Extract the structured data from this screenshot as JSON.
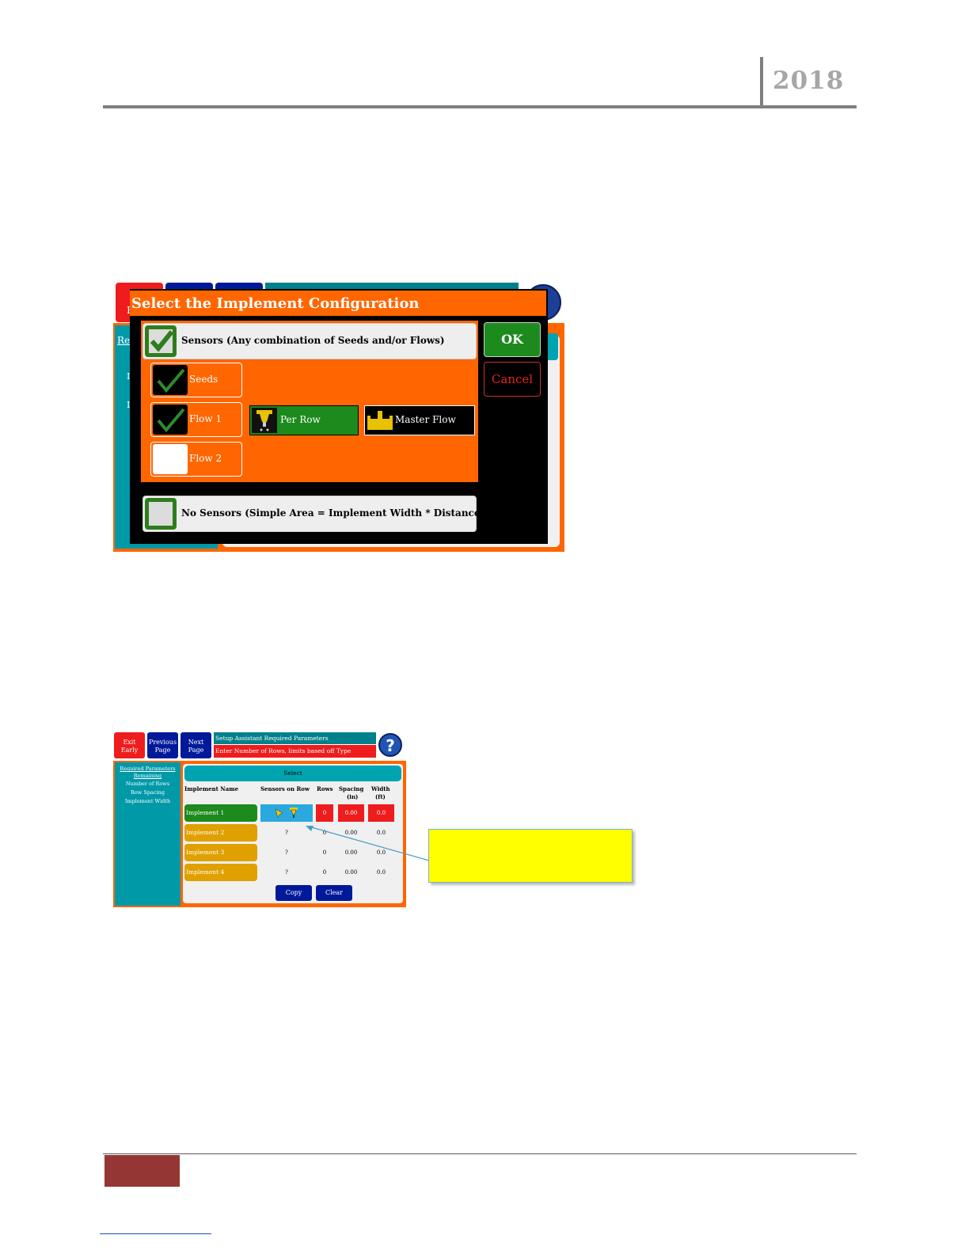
{
  "header": {
    "year": "2018"
  },
  "shot1": {
    "title": "Select the Implement Configuration",
    "sensors_label": "Sensors (Any combination of Seeds and/or Flows)",
    "seeds_label": "Seeds",
    "flow1_label": "Flow 1",
    "flow2_label": "Flow 2",
    "per_row_label": "Per Row",
    "master_flow_label": "Master Flow",
    "no_sensors_label": "No Sensors (Simple Area = Implement Width * Distance)",
    "ok_label": "OK",
    "cancel_label": "Cancel",
    "background_partial": {
      "side_link": "Re",
      "side_letter1": "I",
      "side_letter2": "I",
      "button_letter": "E"
    }
  },
  "shot2": {
    "exit_label": "Exit Early",
    "prev_label": "Previous Page",
    "next_label": "Next Page",
    "header_title": "Setup Assistant Required Parameters",
    "header_subtitle": "Enter Number of Rows, limits based off Type",
    "help_symbol": "?",
    "sidebar": {
      "heading1": "Required Parameters",
      "heading2": "Remaining",
      "items": [
        "Number of Rows",
        "Row Spacing",
        "Implement Width"
      ]
    },
    "select_label": "Select",
    "columns": {
      "name": "Implement Name",
      "sensors": "Sensors on Row",
      "rows": "Rows",
      "spacing": "Spacing",
      "spacing_unit": "(in)",
      "width": "Width",
      "width_unit": "(ft)"
    },
    "implements": [
      {
        "name": "Implement 1",
        "sensors": "",
        "rows": "0",
        "spacing": "0.00",
        "width": "0.0",
        "color": "#1d8a1d"
      },
      {
        "name": "Implement 2",
        "sensors": "?",
        "rows": "0",
        "spacing": "0.00",
        "width": "0.0",
        "color": "#e0a000"
      },
      {
        "name": "Implement 3",
        "sensors": "?",
        "rows": "0",
        "spacing": "0.00",
        "width": "0.0",
        "color": "#e0a000"
      },
      {
        "name": "Implement 4",
        "sensors": "?",
        "rows": "0",
        "spacing": "0.00",
        "width": "0.0",
        "color": "#e0a000"
      }
    ],
    "copy_label": "Copy",
    "clear_label": "Clear"
  },
  "colors": {
    "orange": "#ff6600",
    "teal": "#0099a8",
    "red": "#ee1c1c",
    "navy": "#00199a",
    "green": "#1d8a1d",
    "footer_block": "#943634"
  }
}
